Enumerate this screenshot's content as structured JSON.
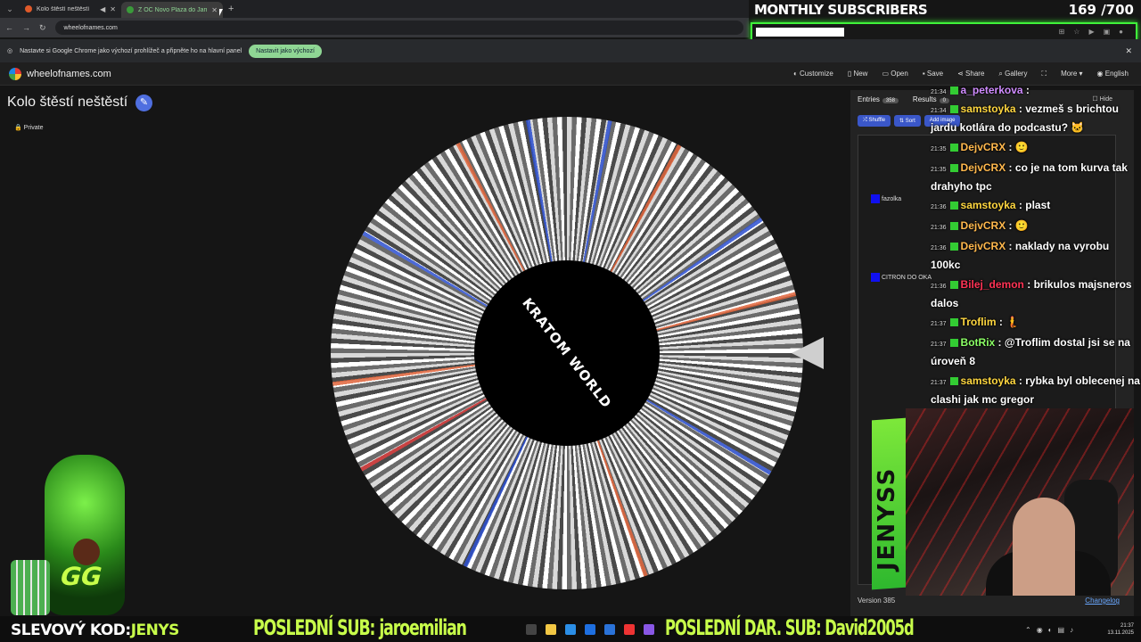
{
  "browser": {
    "tab_menu_icon": "chevron-down-icon",
    "tabs": [
      {
        "label": "Kolo štěstí neštěstí",
        "state": "audio-playing"
      },
      {
        "label": "Z OC Novo Plaza do James De",
        "state": "active"
      }
    ],
    "new_tab_label": "+",
    "url": "wheelofnames.com"
  },
  "infobar": {
    "text": "Nastavte si Google Chrome jako výchozí prohlížeč a připněte ho na hlavní panel",
    "button": "Nastavit jako výchozí",
    "close": "✕"
  },
  "site": {
    "name": "wheelofnames.com",
    "nav": [
      "Customize",
      "New",
      "Open",
      "Save",
      "Share",
      "Gallery",
      "More",
      "English"
    ]
  },
  "page": {
    "title": "Kolo štěstí neštěstí",
    "edit_icon": "pencil-icon",
    "visibility": "Private",
    "lock_icon": "lock-icon"
  },
  "wheel": {
    "center_text": "KRATOM WORLD",
    "pointer_icon": "triangle-pointer-icon",
    "accent_colors": [
      "#2c4fd0",
      "#e0643a",
      "#c62828"
    ]
  },
  "panel": {
    "tab_entries": "Entries",
    "entries_count": "358",
    "tab_results": "Results",
    "results_count": "0",
    "hide": "Hide",
    "buttons": [
      "Shuffle",
      "Sort",
      "Add image"
    ],
    "visible_entries": [
      "fazolka",
      "CITRON DO OKA"
    ],
    "version": "Version 385",
    "changelog": "Changelog"
  },
  "overlay": {
    "subs_title": "MONTHLY SUBSCRIBERS",
    "subs_count": "169 /700",
    "subs_progress": 0.241,
    "accent": "#3ff23a",
    "discount_label": "SLEVOVÝ KOD:",
    "discount_code": "JENYS",
    "last_sub": "POSLEDNÍ SUB: jaroemilian",
    "last_dar": "POSLEDNÍ DAR. SUB: David2005d",
    "brand": "JENYSS",
    "mascot_logo": "GG"
  },
  "chat": [
    {
      "time": "21:34",
      "user": "a_peterkova",
      "color": "#d08cff",
      "text": ""
    },
    {
      "time": "21:34",
      "user": "samstoyka",
      "color": "#ffd740",
      "text": "vezmeš s brichtou jardu kotlára do podcastu? 🐱"
    },
    {
      "time": "21:35",
      "user": "DejvCRX",
      "color": "#ffb84d",
      "text": "🙂"
    },
    {
      "time": "21:35",
      "user": "DejvCRX",
      "color": "#ffb84d",
      "text": "co je na tom kurva tak drahyho tpc"
    },
    {
      "time": "21:36",
      "user": "samstoyka",
      "color": "#ffd740",
      "text": "plast"
    },
    {
      "time": "21:36",
      "user": "DejvCRX",
      "color": "#ffb84d",
      "text": "🙂"
    },
    {
      "time": "21:36",
      "user": "DejvCRX",
      "color": "#ffb84d",
      "text": "naklady na vyrobu 100kc"
    },
    {
      "time": "21:36",
      "user": "Bilej_demon",
      "color": "#ff3355",
      "text": "brikulos majsneros dalos"
    },
    {
      "time": "21:37",
      "user": "Troflim",
      "color": "#ffd740",
      "text": "🧜"
    },
    {
      "time": "21:37",
      "user": "BotRix",
      "color": "#8cff66",
      "text": "@Troflim dostal jsi se na úroveň 8"
    },
    {
      "time": "21:37",
      "user": "samstoyka",
      "color": "#ffd740",
      "text": "rybka byl oblecenej na clashi jak mc gregor"
    }
  ],
  "system_tray": {
    "time": "21:37",
    "date": "13.11.2025"
  }
}
